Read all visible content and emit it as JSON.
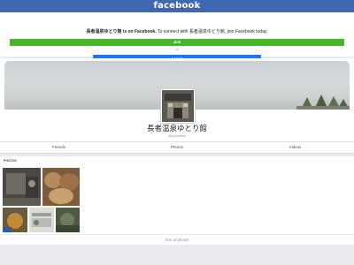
{
  "header": {
    "logo": "facebook"
  },
  "banner": {
    "page_name_bold": "長者温泉ゆとり館 is on Facebook.",
    "message": " To connect with 長者温泉ゆとり館, join Facebook today.",
    "join_label": "Join",
    "or_label": "or",
    "login_label": "Log In"
  },
  "profile": {
    "name": "長者温泉ゆとり館",
    "handle": "@yutorikan"
  },
  "tabs": [
    {
      "label": "Friends"
    },
    {
      "label": "Photos"
    },
    {
      "label": "Videos"
    }
  ],
  "photos": {
    "title": "PHOTOS",
    "see_all": "See all photos"
  },
  "colors": {
    "brand": "#4267b2",
    "join": "#42b72a",
    "login": "#1877f2"
  }
}
